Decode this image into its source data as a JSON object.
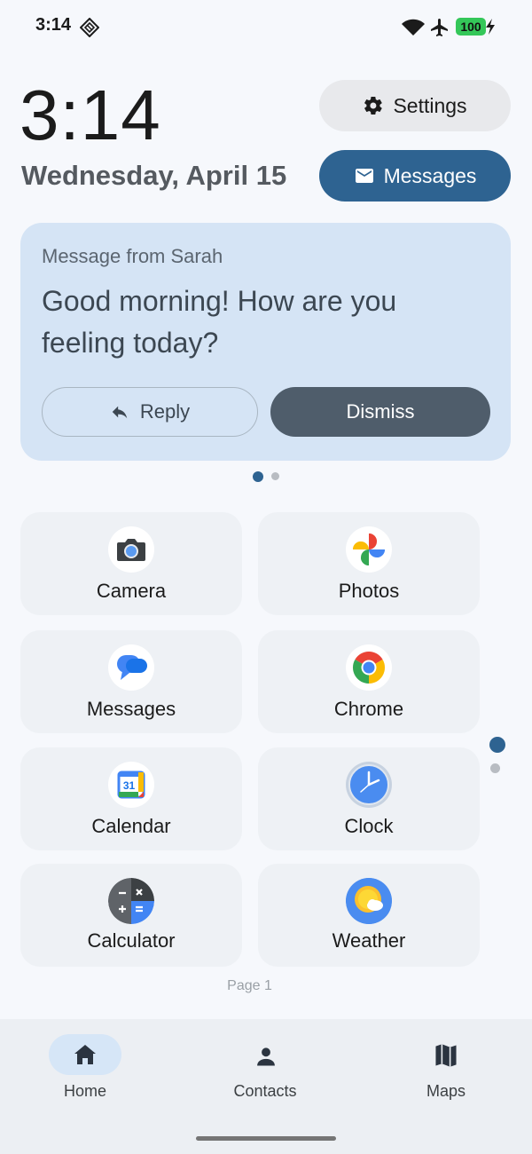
{
  "status_bar": {
    "time": "3:14",
    "battery": "100"
  },
  "lock": {
    "clock": "3:14",
    "date": "Wednesday, April 15"
  },
  "header": {
    "settings_label": "Settings",
    "messages_label": "Messages"
  },
  "notification": {
    "from": "Message from Sarah",
    "text": "Good morning! How are you feeling today?",
    "reply_label": "Reply",
    "dismiss_label": "Dismiss"
  },
  "apps": [
    {
      "label": "Camera",
      "icon": "camera-icon"
    },
    {
      "label": "Photos",
      "icon": "photos-icon"
    },
    {
      "label": "Messages",
      "icon": "messages-icon"
    },
    {
      "label": "Chrome",
      "icon": "chrome-icon"
    },
    {
      "label": "Calendar",
      "icon": "calendar-icon",
      "icon_text": "31"
    },
    {
      "label": "Clock",
      "icon": "clock-icon"
    },
    {
      "label": "Calculator",
      "icon": "calculator-icon"
    },
    {
      "label": "Weather",
      "icon": "weather-icon"
    }
  ],
  "page_indicator": "Page 1",
  "bottom_nav": {
    "items": [
      {
        "label": "Home",
        "icon": "home-icon",
        "active": true
      },
      {
        "label": "Contacts",
        "icon": "person-icon",
        "active": false
      },
      {
        "label": "Maps",
        "icon": "map-icon",
        "active": false
      }
    ]
  },
  "colors": {
    "accent": "#2e6391",
    "card": "#d5e4f5",
    "dismiss": "#4f5d6b"
  }
}
